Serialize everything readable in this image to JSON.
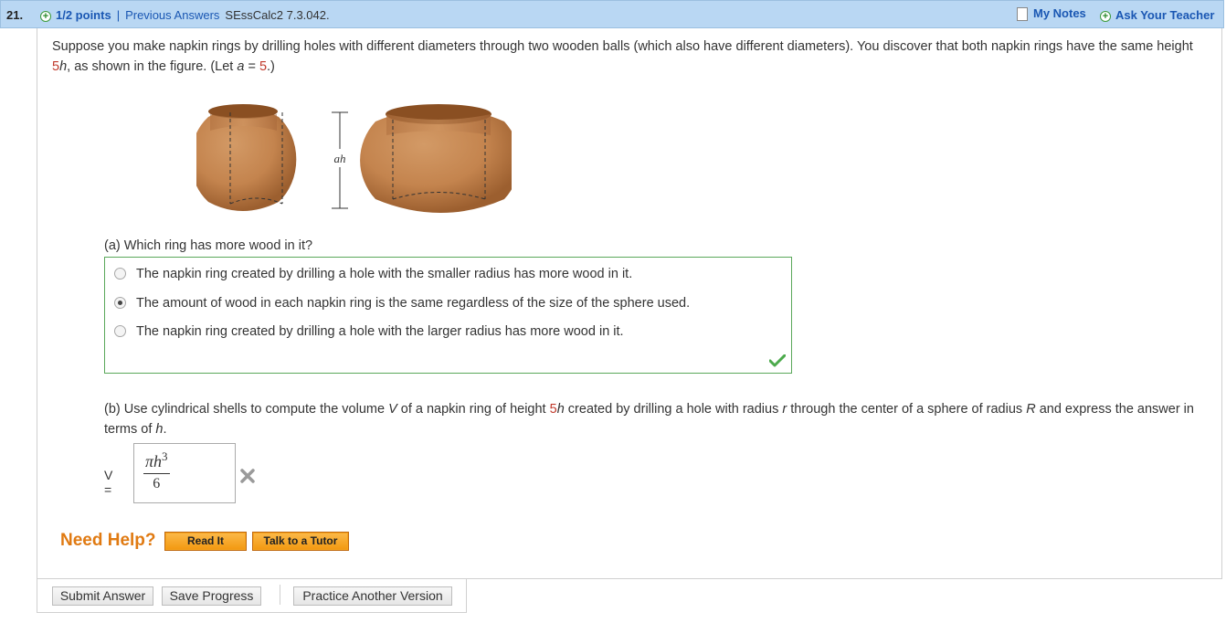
{
  "header": {
    "question_number": "21.",
    "points": "1/2 points",
    "separator": "|",
    "previous_answers": "Previous Answers",
    "question_code": "SEssCalc2 7.3.042.",
    "my_notes": "My Notes",
    "ask_teacher": "Ask Your Teacher"
  },
  "intro": {
    "text_1": "Suppose you make napkin rings by drilling holes with different diameters through two wooden balls (which also have different diameters). You discover that both napkin rings have the same height ",
    "height_value": "5",
    "height_var": "h",
    "text_2": ", as shown in the figure. (Let ",
    "a_var": "a",
    "text_3": " = ",
    "a_value": "5",
    "text_4": ".)"
  },
  "figure": {
    "dimension_label": "ah",
    "wood_color": "#c4844e"
  },
  "part_a": {
    "question": "(a) Which ring has more wood in it?",
    "choices": [
      "The napkin ring created by drilling a hole with the smaller radius has more wood in it.",
      "The amount of wood in each napkin ring is the same regardless of the size of the sphere used.",
      "The napkin ring created by drilling a hole with the larger radius has more wood in it."
    ],
    "selected_index": 1,
    "result": "correct"
  },
  "part_b": {
    "text_1": "(b) Use cylindrical shells to compute the volume ",
    "V": "V",
    "text_2": " of a napkin ring of height ",
    "height_value": "5",
    "h": "h",
    "text_3": " created by drilling a hole with radius ",
    "r": "r",
    "text_4": " through the center of a sphere of radius ",
    "R": "R",
    "text_5": " and express the answer in terms of ",
    "h2": "h",
    "text_6": ".",
    "answer_label": "V =",
    "answer_numerator": "πh",
    "answer_exponent": "3",
    "answer_denominator": "6",
    "result": "incorrect"
  },
  "help": {
    "label": "Need Help?",
    "read_it": "Read It",
    "talk_tutor": "Talk to a Tutor"
  },
  "actions": {
    "submit": "Submit Answer",
    "save": "Save Progress",
    "practice": "Practice Another Version"
  }
}
